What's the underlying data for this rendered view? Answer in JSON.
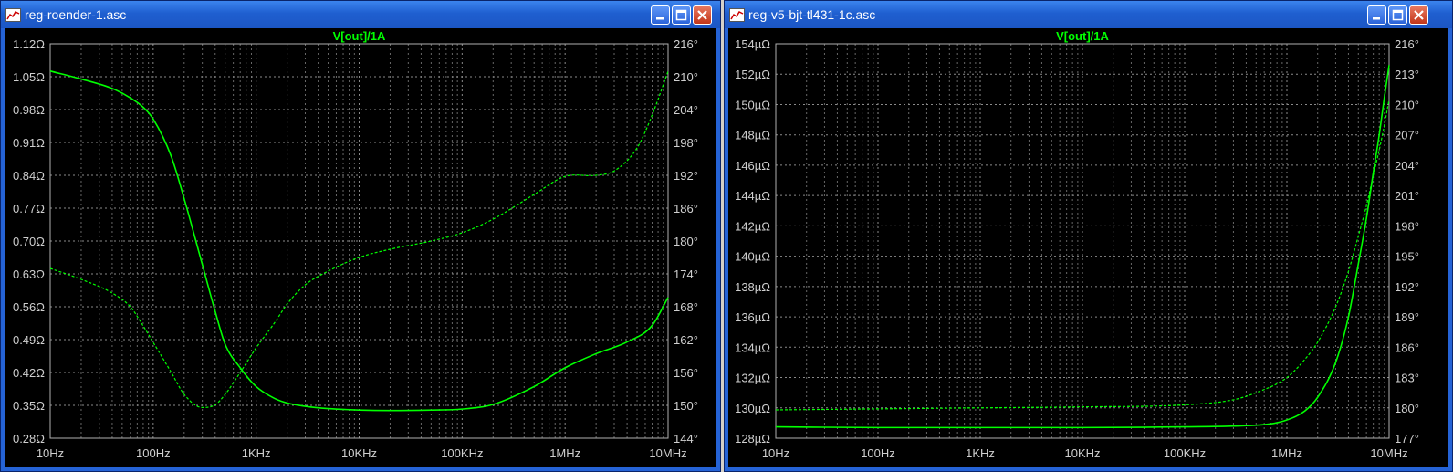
{
  "windows": [
    {
      "title": "reg-roender-1.asc",
      "trace_label": "V[out]/1A",
      "trace_color": "#00ff00",
      "chart_data": {
        "type": "line",
        "x_scale": "log",
        "xlim": [
          10,
          10000000
        ],
        "x_tick_values": [
          10,
          100,
          1000,
          10000,
          100000,
          1000000,
          10000000
        ],
        "x_tick_labels": [
          "10Hz",
          "100Hz",
          "1KHz",
          "10KHz",
          "100KHz",
          "1MHz",
          "10MHz"
        ],
        "y_left_ticks": [
          "0.28Ω",
          "0.35Ω",
          "0.42Ω",
          "0.49Ω",
          "0.56Ω",
          "0.63Ω",
          "0.70Ω",
          "0.77Ω",
          "0.84Ω",
          "0.91Ω",
          "0.98Ω",
          "1.05Ω",
          "1.12Ω"
        ],
        "y_right_ticks": [
          "144°",
          "150°",
          "156°",
          "162°",
          "168°",
          "174°",
          "180°",
          "186°",
          "192°",
          "198°",
          "204°",
          "210°",
          "216°"
        ],
        "ylim_left": [
          0.28,
          1.12
        ],
        "ylim_right": [
          144,
          216
        ],
        "grid": true,
        "series": [
          {
            "axis": "left",
            "style": "solid",
            "x": [
              10,
              20,
              40,
              60,
              80,
              100,
              150,
              200,
              300,
              400,
              500,
              700,
              1000,
              1500,
              2000,
              3000,
              5000,
              10000,
              20000,
              50000,
              100000,
              200000,
              500000,
              1000000,
              2000000,
              4000000,
              7000000,
              10000000
            ],
            "y": [
              1.062,
              1.045,
              1.025,
              1.005,
              0.985,
              0.96,
              0.88,
              0.79,
              0.65,
              0.55,
              0.48,
              0.43,
              0.39,
              0.365,
              0.355,
              0.348,
              0.343,
              0.34,
              0.339,
              0.34,
              0.342,
              0.352,
              0.39,
              0.43,
              0.46,
              0.485,
              0.52,
              0.58
            ]
          },
          {
            "axis": "right",
            "style": "dashed",
            "x": [
              10,
              20,
              40,
              60,
              80,
              100,
              150,
              200,
              300,
              400,
              500,
              700,
              1000,
              1500,
              2000,
              3000,
              5000,
              10000,
              20000,
              50000,
              100000,
              200000,
              500000,
              1000000,
              2000000,
              3000000,
              5000000,
              7000000,
              10000000
            ],
            "y": [
              175.0,
              173.0,
              170.5,
              168.0,
              164.5,
              161.5,
              156.0,
              152.0,
              149.6,
              150.1,
              152.0,
              156.0,
              160.5,
              165.0,
              168.5,
              172.0,
              174.5,
              177.0,
              178.5,
              180.0,
              181.5,
              184.0,
              188.5,
              191.8,
              192.0,
              192.8,
              197.0,
              203.0,
              211.0
            ]
          }
        ]
      }
    },
    {
      "title": "reg-v5-bjt-tl431-1c.asc",
      "trace_label": "V[out]/1A",
      "trace_color": "#00ff00",
      "chart_data": {
        "type": "line",
        "x_scale": "log",
        "xlim": [
          10,
          10000000
        ],
        "x_tick_values": [
          10,
          100,
          1000,
          10000,
          100000,
          1000000,
          10000000
        ],
        "x_tick_labels": [
          "10Hz",
          "100Hz",
          "1KHz",
          "10KHz",
          "100KHz",
          "1MHz",
          "10MHz"
        ],
        "y_left_ticks": [
          "128µΩ",
          "130µΩ",
          "132µΩ",
          "134µΩ",
          "136µΩ",
          "138µΩ",
          "140µΩ",
          "142µΩ",
          "144µΩ",
          "146µΩ",
          "148µΩ",
          "150µΩ",
          "152µΩ",
          "154µΩ"
        ],
        "y_right_ticks": [
          "177°",
          "180°",
          "183°",
          "186°",
          "189°",
          "192°",
          "195°",
          "198°",
          "201°",
          "204°",
          "207°",
          "210°",
          "213°",
          "216°"
        ],
        "ylim_left": [
          128,
          154
        ],
        "ylim_right": [
          177,
          216
        ],
        "grid": true,
        "series": [
          {
            "axis": "left",
            "style": "solid",
            "x": [
              10,
              100,
              1000,
              10000,
              100000,
              300000,
              700000,
              1000000,
              1500000,
              2000000,
              3000000,
              4000000,
              5000000,
              6000000,
              7000000,
              8000000,
              9000000,
              10000000
            ],
            "y": [
              128.75,
              128.7,
              128.7,
              128.7,
              128.75,
              128.8,
              128.95,
              129.2,
              129.8,
              130.7,
              133.0,
              136.0,
              139.5,
              142.5,
              145.5,
              148.0,
              150.5,
              152.6
            ]
          },
          {
            "axis": "right",
            "style": "dashed",
            "x": [
              10,
              100,
              1000,
              10000,
              100000,
              300000,
              500000,
              1000000,
              1500000,
              2000000,
              3000000,
              4000000,
              5000000,
              6000000,
              7000000,
              8000000,
              9000000,
              10000000
            ],
            "y": [
              179.8,
              179.9,
              180.0,
              180.1,
              180.3,
              180.8,
              181.5,
              183.0,
              184.8,
              186.5,
              190.0,
              193.5,
              197.0,
              200.0,
              203.0,
              205.5,
              208.0,
              210.5
            ]
          }
        ]
      }
    }
  ]
}
